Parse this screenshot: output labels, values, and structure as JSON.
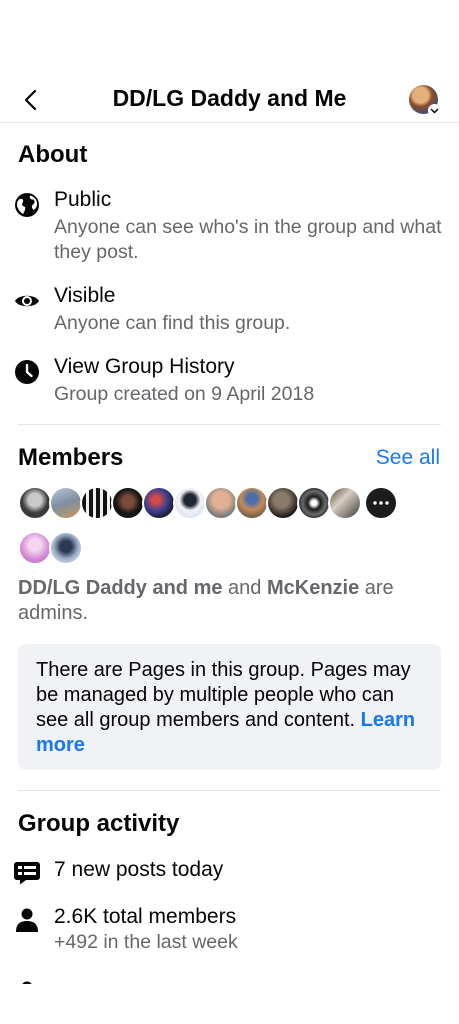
{
  "header": {
    "title": "DD/LG Daddy and Me"
  },
  "about": {
    "title": "About",
    "items": [
      {
        "icon": "globe-icon",
        "title": "Public",
        "subtitle": "Anyone can see who's in the group and what they post."
      },
      {
        "icon": "eye-icon",
        "title": "Visible",
        "subtitle": "Anyone can find this group."
      },
      {
        "icon": "clock-icon",
        "title": "View Group History",
        "subtitle": "Group created on 9 April 2018"
      }
    ]
  },
  "members": {
    "title": "Members",
    "see_all": "See all",
    "avatar_count_row1": 12,
    "avatar_count_row2": 2,
    "admin_1": "DD/LG Daddy and me",
    "admin_and": " and ",
    "admin_2": "McKenzie",
    "admin_suffix": " are admins."
  },
  "pages_notice": {
    "text": "There are Pages in this group. Pages may be managed by multiple people who can see all group members and content. ",
    "link": "Learn more"
  },
  "activity": {
    "title": "Group activity",
    "items": [
      {
        "icon": "posts-icon",
        "title": "7 new posts today",
        "subtitle": ""
      },
      {
        "icon": "person-icon",
        "title": "2.6K total members",
        "subtitle": "+492 in the last week"
      }
    ]
  },
  "colors": {
    "link": "#1877f2",
    "secondary_text": "#65676b",
    "notice_bg": "#f0f2f5"
  }
}
